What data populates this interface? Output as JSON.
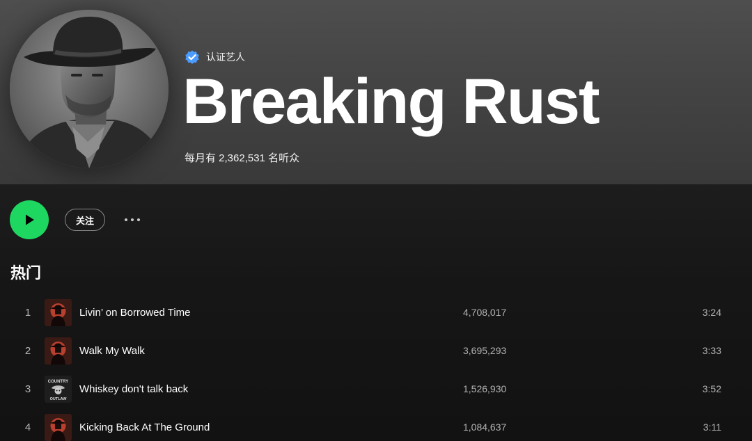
{
  "artist": {
    "verified_label": "认证艺人",
    "name": "Breaking Rust",
    "monthly_listeners": "每月有 2,362,531 名听众",
    "avatar_icon": "cowboy-portrait"
  },
  "actions": {
    "play_icon": "play-icon",
    "follow_label": "关注",
    "more_icon": "more-options-icon"
  },
  "popular": {
    "title": "热门",
    "tracks": [
      {
        "number": "1",
        "title": "Livin’ on Borrowed Time",
        "plays": "4,708,017",
        "duration": "3:24",
        "art": "cowboy-sunset"
      },
      {
        "number": "2",
        "title": "Walk My Walk",
        "plays": "3,695,293",
        "duration": "3:33",
        "art": "cowboy-sunset"
      },
      {
        "number": "3",
        "title": "Whiskey don't talk back",
        "plays": "1,526,930",
        "duration": "3:52",
        "art": "country-outlaw"
      },
      {
        "number": "4",
        "title": "Kicking Back At The Ground",
        "plays": "1,084,637",
        "duration": "3:11",
        "art": "cowboy-sunset"
      }
    ],
    "art_badge_text": {
      "top": "COUNTRY",
      "bottom": "OUTLAW"
    }
  },
  "colors": {
    "accent": "#1ed760",
    "verified": "#4c9cff",
    "background": "#121212",
    "header": "#474747"
  }
}
